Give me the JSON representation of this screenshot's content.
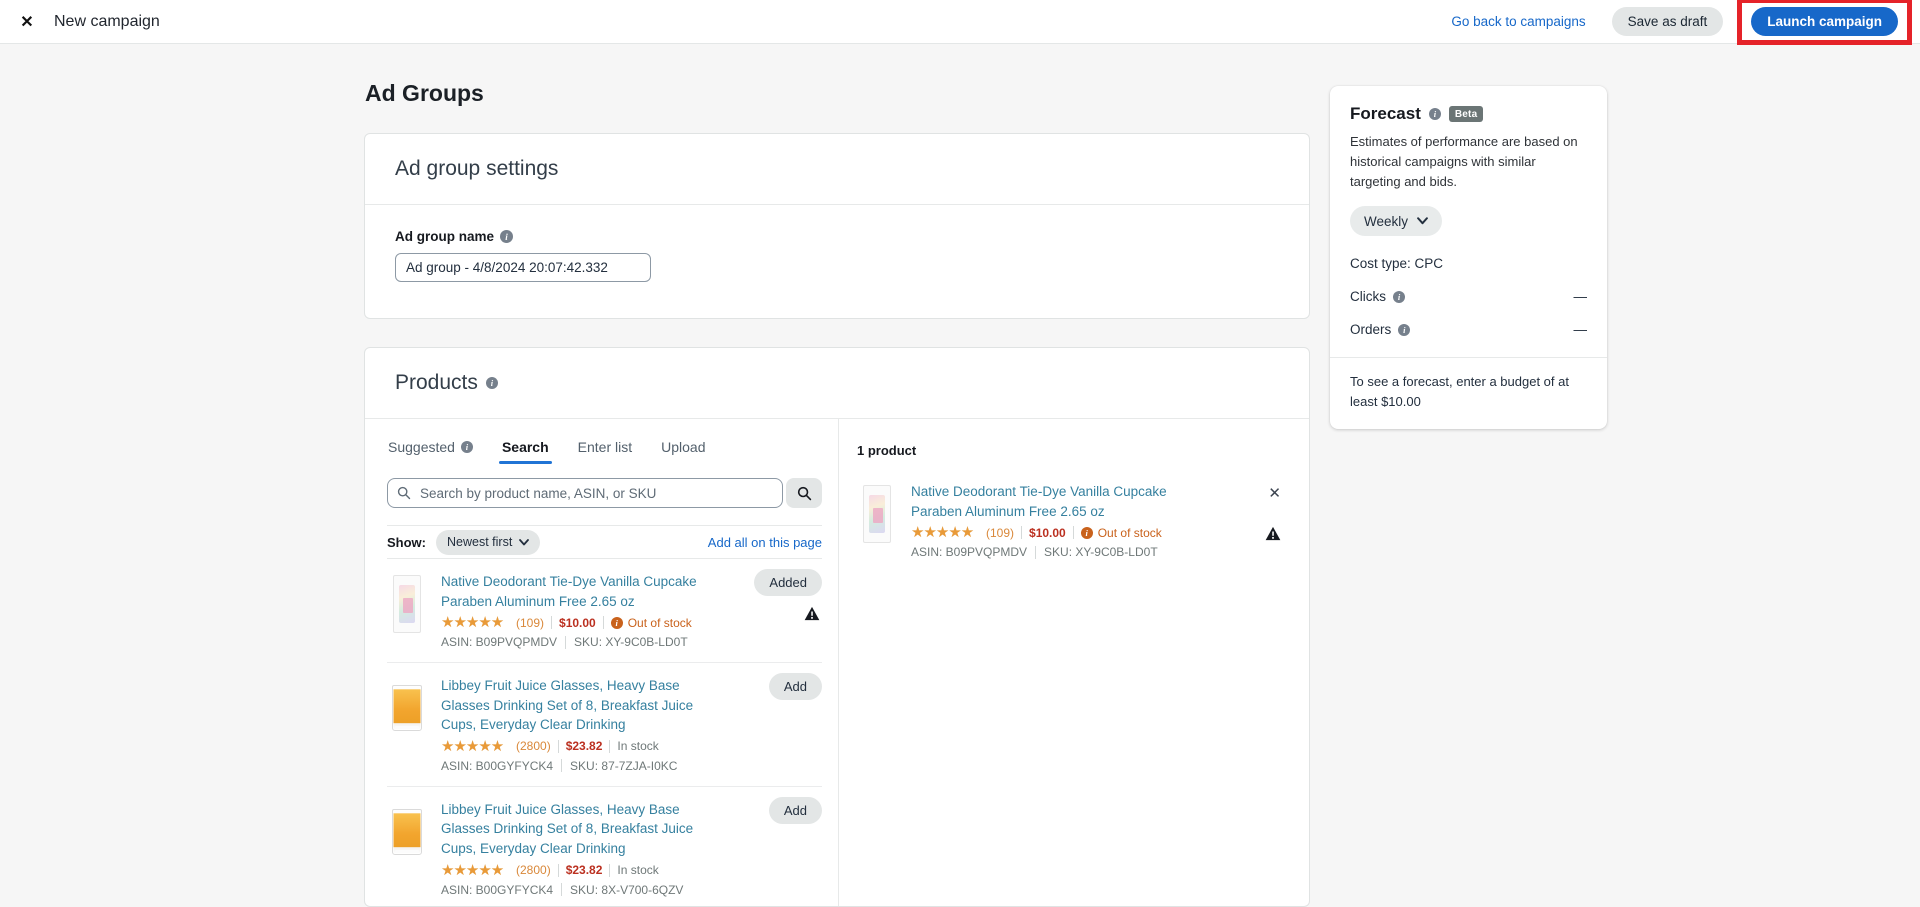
{
  "topbar": {
    "title": "New campaign",
    "go_back_label": "Go back to campaigns",
    "save_draft_label": "Save as draft",
    "launch_label": "Launch campaign"
  },
  "page": {
    "heading": "Ad Groups"
  },
  "ad_group_settings": {
    "title": "Ad group settings",
    "name_label": "Ad group name",
    "name_value": "Ad group - 4/8/2024 20:07:42.332"
  },
  "products": {
    "title": "Products",
    "tabs": [
      {
        "label": "Suggested"
      },
      {
        "label": "Search"
      },
      {
        "label": "Enter list"
      },
      {
        "label": "Upload"
      }
    ],
    "search_placeholder": "Search by product name, ASIN, or SKU",
    "show_label": "Show:",
    "sort_value": "Newest first",
    "add_all_label": "Add all on this page",
    "items": [
      {
        "title": "Native Deodorant Tie-Dye Vanilla Cupcake Paraben Aluminum Free 2.65 oz",
        "rating": 4.5,
        "rating_count": "(109)",
        "price": "$10.00",
        "stock": "Out of stock",
        "asin": "ASIN: B09PVQPMDV",
        "sku": "SKU: XY-9C0B-LD0T",
        "button_label": "Added"
      },
      {
        "title": "Libbey Fruit Juice Glasses, Heavy Base Glasses Drinking Set of 8, Breakfast Juice Cups, Everyday Clear Drinking",
        "rating": 4.5,
        "rating_count": "(2800)",
        "price": "$23.82",
        "stock": "In stock",
        "asin": "ASIN: B00GYFYCK4",
        "sku": "SKU: 87-7ZJA-I0KC",
        "button_label": "Add"
      },
      {
        "title": "Libbey Fruit Juice Glasses, Heavy Base Glasses Drinking Set of 8, Breakfast Juice Cups, Everyday Clear Drinking",
        "rating": 4.5,
        "rating_count": "(2800)",
        "price": "$23.82",
        "stock": "In stock",
        "asin": "ASIN: B00GYFYCK4",
        "sku": "SKU: 8X-V700-6QZV",
        "button_label": "Add"
      }
    ],
    "selected_count": "1 product"
  },
  "forecast": {
    "title": "Forecast",
    "beta_label": "Beta",
    "description": "Estimates of performance are based on historical campaigns with similar targeting and bids.",
    "period_value": "Weekly",
    "cost_type": "Cost type: CPC",
    "metrics": [
      {
        "label": "Clicks",
        "value": "—"
      },
      {
        "label": "Orders",
        "value": "—"
      }
    ],
    "footnote": "To see a forecast, enter a budget of at least $10.00"
  },
  "icons": {
    "close": "x-cross",
    "search": "magnifier",
    "info": "circle-i",
    "chevron": "chevron-down",
    "warning": "black-triangle-exclamation"
  },
  "colors": {
    "link_blue": "#1768c9",
    "launch_blue": "#1768c9",
    "annotation_red": "#e52329",
    "tab_underline": "#2074d5",
    "product_title_teal": "#35809f",
    "star_orange": "#e99a38",
    "price_red": "#bb3020",
    "stock_out_orange": "#c9621c",
    "page_bg": "#f6f6f6"
  }
}
